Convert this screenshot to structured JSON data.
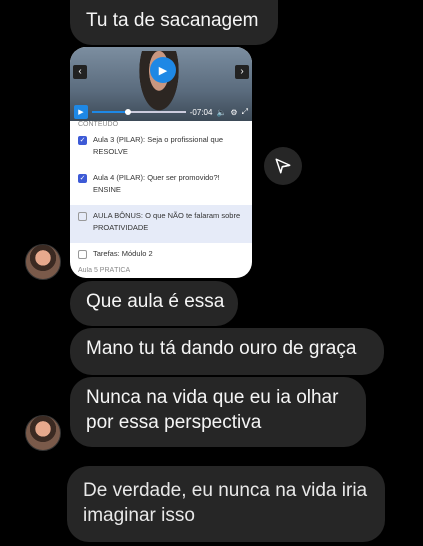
{
  "messages": [
    "Tu ta de sacanagem",
    "Que aula é essa",
    "Mano tu tá dando ouro de graça",
    "Nunca na vida que eu ia olhar por essa perspectiva",
    "De verdade, eu nunca na vida iria imaginar isso"
  ],
  "post": {
    "video_time": "-07:04",
    "progress": 0.35,
    "lessons_header_partial": "CONTEÚDO",
    "lessons": [
      {
        "title": "Aula 3 (PILAR): Seja o profissional que RESOLVE",
        "checked": true
      },
      {
        "title": "Aula 4 (PILAR): Quer ser promovido?! ENSINE",
        "checked": true
      },
      {
        "title": "AULA BÔNUS: O que NÃO te falaram sobre PROATIVIDADE",
        "checked": false,
        "highlighted": true
      },
      {
        "title": "Tarefas: Módulo 2",
        "checked": false
      }
    ],
    "lessons_footer_partial": "Aula 5 PRÁTICA"
  },
  "icons": {
    "share": "send-icon",
    "play": "play-icon",
    "volume": "volume-icon",
    "settings": "settings-icon",
    "fullscreen": "fullscreen-icon"
  }
}
